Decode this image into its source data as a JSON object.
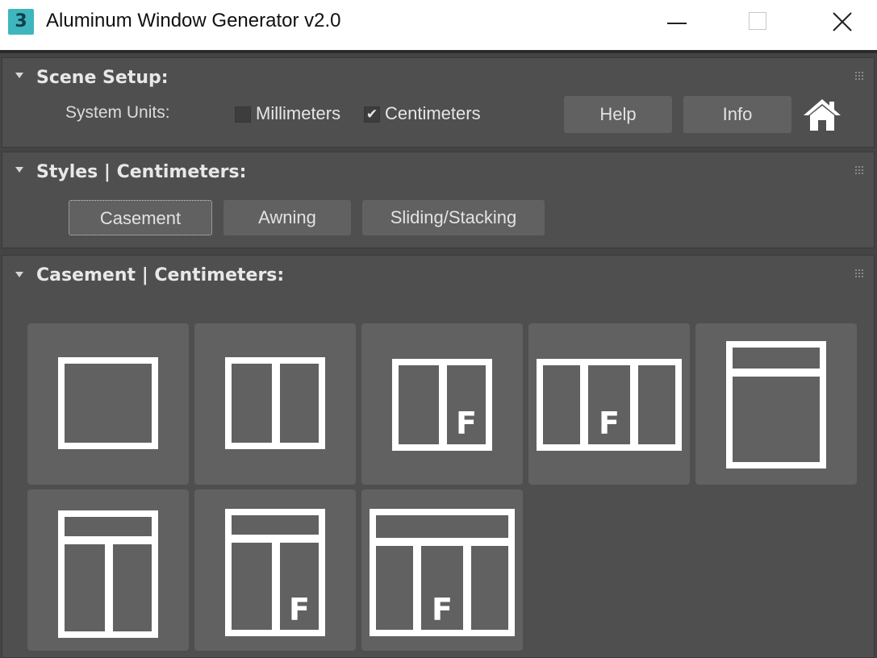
{
  "window": {
    "title": "Aluminum Window Generator v2.0",
    "app_icon_text": "3",
    "controls": [
      "minimize",
      "maximize",
      "close"
    ]
  },
  "scene_setup": {
    "title": "Scene Setup:",
    "units_label": "System Units:",
    "options": [
      {
        "label": "Millimeters",
        "checked": false
      },
      {
        "label": "Centimeters",
        "checked": true
      }
    ],
    "help_label": "Help",
    "info_label": "Info",
    "home_icon": "home-icon"
  },
  "styles": {
    "title": "Styles | Centimeters:",
    "buttons": [
      "Casement",
      "Awning",
      "Sliding/Stacking"
    ],
    "selected": "Casement"
  },
  "casement": {
    "title": "Casement | Centimeters:",
    "presets": [
      {
        "icon": "window-single-icon"
      },
      {
        "icon": "window-double-icon"
      },
      {
        "icon": "window-double-fixed-icon",
        "mark": "F"
      },
      {
        "icon": "window-triple-fixed-center-icon",
        "mark": "F"
      },
      {
        "icon": "window-transom-single-icon"
      },
      {
        "icon": "window-transom-double-icon"
      },
      {
        "icon": "window-transom-double-fixed-icon",
        "mark": "F"
      },
      {
        "icon": "window-transom-triple-fixed-icon",
        "mark": "F"
      }
    ]
  },
  "colors": {
    "panel_bg": "#4f4f4f",
    "button_bg": "#616161",
    "title_text": "#e8e8e8",
    "glyph": "#ffffff"
  }
}
